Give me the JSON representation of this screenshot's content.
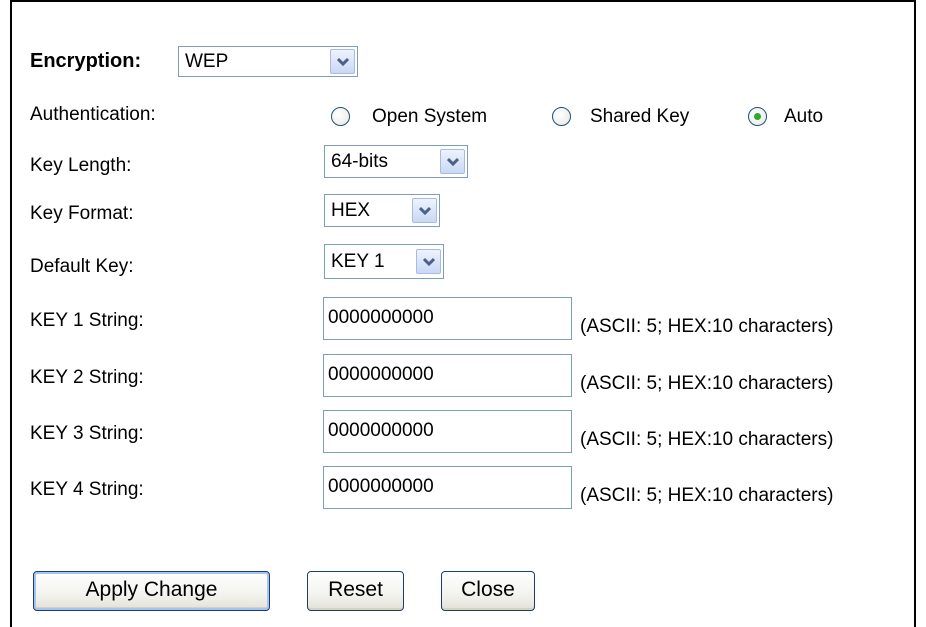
{
  "encryption": {
    "label": "Encryption:",
    "selected": "WEP"
  },
  "authentication": {
    "label": "Authentication:",
    "options": [
      {
        "label": "Open System",
        "checked": false
      },
      {
        "label": "Shared Key",
        "checked": false
      },
      {
        "label": "Auto",
        "checked": true
      }
    ]
  },
  "key_length": {
    "label": "Key Length:",
    "selected": "64-bits"
  },
  "key_format": {
    "label": "Key Format:",
    "selected": "HEX"
  },
  "default_key": {
    "label": "Default Key:",
    "selected": "KEY 1"
  },
  "keys": [
    {
      "label": "KEY 1 String:",
      "value": "0000000000",
      "hint": "(ASCII: 5; HEX:10 characters)"
    },
    {
      "label": "KEY 2 String:",
      "value": "0000000000",
      "hint": "(ASCII: 5; HEX:10 characters)"
    },
    {
      "label": "KEY 3 String:",
      "value": "0000000000",
      "hint": "(ASCII: 5; HEX:10 characters)"
    },
    {
      "label": "KEY 4 String:",
      "value": "0000000000",
      "hint": "(ASCII: 5; HEX:10 characters)"
    }
  ],
  "buttons": {
    "apply": "Apply Change",
    "reset": "Reset",
    "close": "Close"
  },
  "icons": {
    "dropdown": "chevron-down-icon",
    "radio_checked_color": "#2fa82f"
  }
}
